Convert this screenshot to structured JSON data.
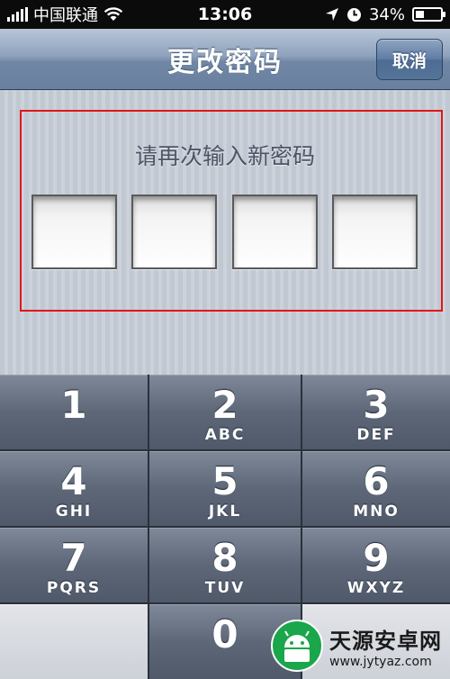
{
  "status_bar": {
    "carrier": "中国联通",
    "time": "13:06",
    "battery": "34%",
    "battery_level": 0.34,
    "icons": [
      "signal-icon",
      "wifi-icon",
      "location-arrow-icon",
      "clock-icon",
      "battery-icon"
    ]
  },
  "nav": {
    "title": "更改密码",
    "cancel_label": "取消"
  },
  "passcode": {
    "prompt": "请再次输入新密码",
    "digit_count": 4,
    "highlight_color": "#e01818"
  },
  "keypad": {
    "keys": [
      {
        "digit": "1",
        "letters": ""
      },
      {
        "digit": "2",
        "letters": "ABC"
      },
      {
        "digit": "3",
        "letters": "DEF"
      },
      {
        "digit": "4",
        "letters": "GHI"
      },
      {
        "digit": "5",
        "letters": "JKL"
      },
      {
        "digit": "6",
        "letters": "MNO"
      },
      {
        "digit": "7",
        "letters": "PQRS"
      },
      {
        "digit": "8",
        "letters": "TUV"
      },
      {
        "digit": "9",
        "letters": "WXYZ"
      },
      {
        "digit": "0",
        "letters": ""
      }
    ]
  },
  "watermark": {
    "name": "天源安卓网",
    "url": "www.jytyaz.com"
  }
}
